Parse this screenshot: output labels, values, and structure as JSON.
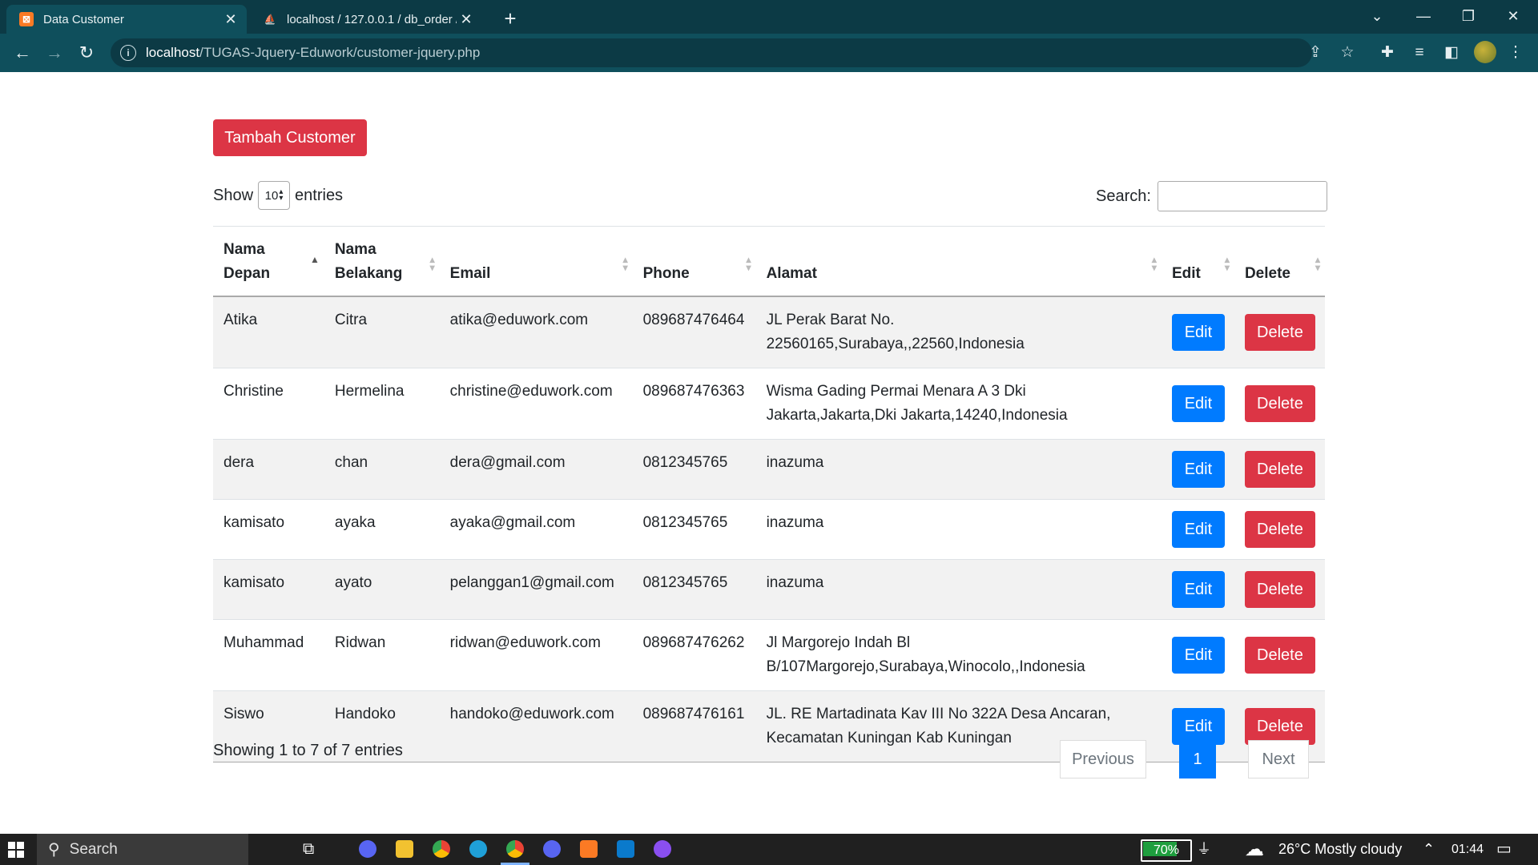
{
  "browser": {
    "tabs": [
      {
        "title": "Data Customer",
        "favicon": "xampp-icon"
      },
      {
        "title": "localhost / 127.0.0.1 / db_order /",
        "favicon": "phpmyadmin-icon"
      }
    ],
    "url_host": "localhost",
    "url_path": "/TUGAS-Jquery-Eduwork/customer-jquery.php"
  },
  "page": {
    "add_button": "Tambah Customer",
    "length": {
      "show": "Show",
      "value": "10",
      "entries": "entries"
    },
    "search_label": "Search:",
    "search_value": "",
    "columns": [
      "Nama Depan",
      "Nama Belakang",
      "Email",
      "Phone",
      "Alamat",
      "Edit",
      "Delete"
    ],
    "rows": [
      {
        "first": "Atika",
        "last": "Citra",
        "email": "atika@eduwork.com",
        "phone": "089687476464",
        "address": "JL Perak Barat No. 22560165,Surabaya,,22560,Indonesia"
      },
      {
        "first": "Christine",
        "last": "Hermelina",
        "email": "christine@eduwork.com",
        "phone": "089687476363",
        "address": "Wisma Gading Permai Menara A 3 Dki Jakarta,Jakarta,Dki Jakarta,14240,Indonesia"
      },
      {
        "first": "dera",
        "last": "chan",
        "email": "dera@gmail.com",
        "phone": "0812345765",
        "address": "inazuma"
      },
      {
        "first": "kamisato",
        "last": "ayaka",
        "email": "ayaka@gmail.com",
        "phone": "0812345765",
        "address": "inazuma"
      },
      {
        "first": "kamisato",
        "last": "ayato",
        "email": "pelanggan1@gmail.com",
        "phone": "0812345765",
        "address": "inazuma"
      },
      {
        "first": "Muhammad",
        "last": "Ridwan",
        "email": "ridwan@eduwork.com",
        "phone": "089687476262",
        "address": "Jl Margorejo Indah Bl B/107Margorejo,Surabaya,Winocolo,,Indonesia"
      },
      {
        "first": "Siswo",
        "last": "Handoko",
        "email": "handoko@eduwork.com",
        "phone": "089687476161",
        "address": "JL. RE Martadinata Kav III No 322A Desa Ancaran, Kecamatan Kuningan Kab Kuningan"
      }
    ],
    "edit_label": "Edit",
    "delete_label": "Delete",
    "info": "Showing 1 to 7 of 7 entries",
    "pagination": {
      "previous": "Previous",
      "current": "1",
      "next": "Next"
    }
  },
  "taskbar": {
    "search": "Search",
    "battery": "70%",
    "weather": "26°C  Mostly cloudy",
    "time": "01:44"
  },
  "colors": {
    "primary": "#007bff",
    "danger": "#dc3545",
    "chrome_bg": "#0f4f5c",
    "taskbar_bg": "#202020"
  }
}
